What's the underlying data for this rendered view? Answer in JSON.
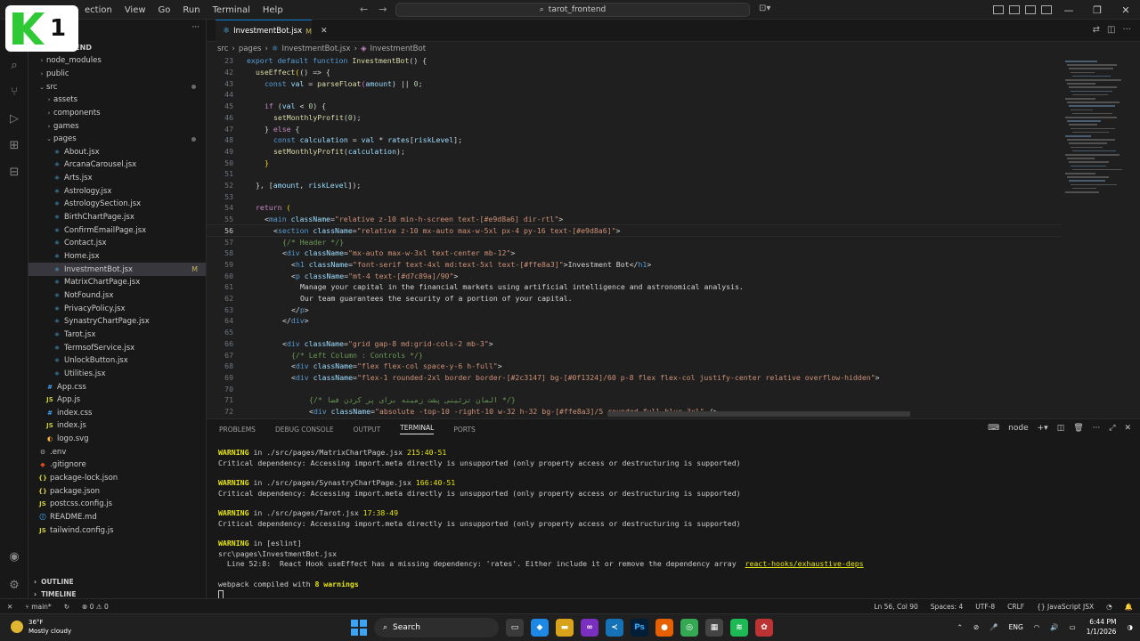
{
  "logo": {
    "number": "1"
  },
  "menu": [
    "ection",
    "View",
    "Go",
    "Run",
    "Terminal",
    "Help"
  ],
  "search": {
    "label": "tarot_frontend"
  },
  "explorer": {
    "root": "NTEND",
    "items": [
      {
        "label": "node_modules",
        "kind": "folder",
        "depth": 1,
        "open": false
      },
      {
        "label": "public",
        "kind": "folder",
        "depth": 1,
        "open": false
      },
      {
        "label": "src",
        "kind": "folder",
        "depth": 1,
        "open": true,
        "dot": true
      },
      {
        "label": "assets",
        "kind": "folder",
        "depth": 2,
        "open": false
      },
      {
        "label": "components",
        "kind": "folder",
        "depth": 2,
        "open": false
      },
      {
        "label": "games",
        "kind": "folder",
        "depth": 2,
        "open": false
      },
      {
        "label": "pages",
        "kind": "folder",
        "depth": 2,
        "open": true,
        "dot": true
      },
      {
        "label": "About.jsx",
        "kind": "jsx",
        "depth": 3
      },
      {
        "label": "ArcanaCarousel.jsx",
        "kind": "jsx",
        "depth": 3
      },
      {
        "label": "Arts.jsx",
        "kind": "jsx",
        "depth": 3
      },
      {
        "label": "Astrology.jsx",
        "kind": "jsx",
        "depth": 3
      },
      {
        "label": "AstrologySection.jsx",
        "kind": "jsx",
        "depth": 3
      },
      {
        "label": "BirthChartPage.jsx",
        "kind": "jsx",
        "depth": 3
      },
      {
        "label": "ConfirmEmailPage.jsx",
        "kind": "jsx",
        "depth": 3
      },
      {
        "label": "Contact.jsx",
        "kind": "jsx",
        "depth": 3
      },
      {
        "label": "Home.jsx",
        "kind": "jsx",
        "depth": 3
      },
      {
        "label": "InvestmentBot.jsx",
        "kind": "jsx",
        "depth": 3,
        "selected": true,
        "badge": "M"
      },
      {
        "label": "MatrixChartPage.jsx",
        "kind": "jsx",
        "depth": 3
      },
      {
        "label": "NotFound.jsx",
        "kind": "jsx",
        "depth": 3
      },
      {
        "label": "PrivacyPolicy.jsx",
        "kind": "jsx",
        "depth": 3
      },
      {
        "label": "SynastryChartPage.jsx",
        "kind": "jsx",
        "depth": 3
      },
      {
        "label": "Tarot.jsx",
        "kind": "jsx",
        "depth": 3
      },
      {
        "label": "TermsofService.jsx",
        "kind": "jsx",
        "depth": 3
      },
      {
        "label": "UnlockButton.jsx",
        "kind": "jsx",
        "depth": 3
      },
      {
        "label": "Utilities.jsx",
        "kind": "jsx",
        "depth": 3
      },
      {
        "label": "App.css",
        "kind": "css",
        "depth": 2
      },
      {
        "label": "App.js",
        "kind": "js",
        "depth": 2
      },
      {
        "label": "index.css",
        "kind": "css",
        "depth": 2
      },
      {
        "label": "index.js",
        "kind": "js",
        "depth": 2
      },
      {
        "label": "logo.svg",
        "kind": "svg",
        "depth": 2
      },
      {
        "label": ".env",
        "kind": "env",
        "depth": 1
      },
      {
        "label": ".gitignore",
        "kind": "git",
        "depth": 1
      },
      {
        "label": "package-lock.json",
        "kind": "json",
        "depth": 1
      },
      {
        "label": "package.json",
        "kind": "json",
        "depth": 1
      },
      {
        "label": "postcss.config.js",
        "kind": "js",
        "depth": 1
      },
      {
        "label": "README.md",
        "kind": "md",
        "depth": 1
      },
      {
        "label": "tailwind.config.js",
        "kind": "js",
        "depth": 1
      }
    ],
    "outline": "OUTLINE",
    "timeline": "TIMELINE"
  },
  "editor": {
    "tab": {
      "label": "InvestmentBot.jsx",
      "modified": "M"
    },
    "breadcrumb": [
      "src",
      "pages",
      "InvestmentBot.jsx",
      "InvestmentBot"
    ],
    "current_line": 56
  },
  "code_lines": [
    {
      "n": "23"
    },
    {
      "n": "42"
    },
    {
      "n": "43"
    },
    {
      "n": "44"
    },
    {
      "n": "45"
    },
    {
      "n": "46"
    },
    {
      "n": "47"
    },
    {
      "n": "48"
    },
    {
      "n": "49"
    },
    {
      "n": "50"
    },
    {
      "n": "51"
    },
    {
      "n": "52"
    },
    {
      "n": "53"
    },
    {
      "n": "54"
    },
    {
      "n": "55"
    },
    {
      "n": "56"
    },
    {
      "n": "57"
    },
    {
      "n": "58"
    },
    {
      "n": "59"
    },
    {
      "n": "60"
    },
    {
      "n": "61"
    },
    {
      "n": "62"
    },
    {
      "n": "63"
    },
    {
      "n": "64"
    },
    {
      "n": "65"
    },
    {
      "n": "66"
    },
    {
      "n": "67"
    },
    {
      "n": "68"
    },
    {
      "n": "69"
    },
    {
      "n": "70"
    },
    {
      "n": "71"
    },
    {
      "n": "72"
    }
  ],
  "code_text": {
    "l23": [
      "export",
      " default",
      " function",
      " InvestmentBot",
      "() {"
    ],
    "l42": [
      "useEffect",
      "(",
      "() => {"
    ],
    "l43": [
      "const",
      " val",
      " = ",
      "parseFloat",
      "(",
      "amount",
      ") || ",
      "0",
      ";"
    ],
    "l45": [
      "if",
      " (",
      "val",
      " < ",
      "0",
      ") {"
    ],
    "l46": [
      "setMonthlyProfit",
      "(",
      "0",
      ");"
    ],
    "l47": [
      "} ",
      "else",
      " {"
    ],
    "l48": [
      "const",
      " calculation",
      " = ",
      "val",
      " * ",
      "rates",
      "[",
      "riskLevel",
      "];"
    ],
    "l49": [
      "setMonthlyProfit",
      "(",
      "calculation",
      ");"
    ],
    "l50": [
      "}"
    ],
    "l52": [
      "}, [",
      "amount",
      ", ",
      "riskLevel",
      "]);"
    ],
    "l54": [
      "return",
      " ("
    ],
    "l55": [
      "<",
      "main",
      " className",
      "=",
      "\"relative z-10 min-h-screen text-[#e9d8a6] dir-rtl\"",
      ">"
    ],
    "l56": [
      "<",
      "section",
      " className",
      "=",
      "\"relative z-10 mx-auto max-w-5xl px-4 py-16 text-[#e9d8a6]\"",
      ">"
    ],
    "l57": [
      "{/* Header */}"
    ],
    "l58": [
      "<",
      "div",
      " className",
      "=",
      "\"mx-auto max-w-3xl text-center mb-12\"",
      ">"
    ],
    "l59": [
      "<",
      "h1",
      " className",
      "=",
      "\"font-serif text-4xl md:text-5xl text-[#ffe8a3]\"",
      ">",
      "Investment Bot",
      "</",
      "h1",
      ">"
    ],
    "l60": [
      "<",
      "p",
      " className",
      "=",
      "\"mt-4 text-[#d7c89a]/90\"",
      ">"
    ],
    "l61": [
      "Manage your capital in the financial markets using artificial intelligence and astronomical analysis."
    ],
    "l62": [
      "Our team guarantees the security of a portion of your capital."
    ],
    "l63": [
      "</",
      "p",
      ">"
    ],
    "l64": [
      "</",
      "div",
      ">"
    ],
    "l66": [
      "<",
      "div",
      " className",
      "=",
      "\"grid gap-8 md:grid-cols-2 mb-3\"",
      ">"
    ],
    "l67": [
      "{/* Left Column : Controls */}"
    ],
    "l68": [
      "<",
      "div",
      " className",
      "=",
      "\"flex flex-col space-y-6 h-full\"",
      ">"
    ],
    "l69": [
      "<",
      "div",
      " className",
      "=",
      "\"flex-1 rounded-2xl border border-[#2c3147] bg-[#0f1324]/60 p-8 flex flex-col justify-center relative overflow-hidden\"",
      ">"
    ],
    "l71": [
      "{/* المان تزئینی پشت زمینه برای پر کردن فضا */}"
    ],
    "l72": [
      "<",
      "div",
      " className",
      "=",
      "\"absolute -top-10 -right-10 w-32 h-32 bg-[#ffe8a3]/5 rounded-full blur-3xl\"",
      " />"
    ]
  },
  "panel": {
    "tabs": [
      "PROBLEMS",
      "DEBUG CONSOLE",
      "OUTPUT",
      "TERMINAL",
      "PORTS"
    ],
    "active_tab": "TERMINAL",
    "shell": "node",
    "terminal": {
      "w1_label": "WARNING",
      "w1_in": " in ",
      "w1_path": "./src/pages/MatrixChartPage.jsx",
      "w1_loc": " 215:40-51",
      "w1_msg": "Critical dependency: Accessing import.meta directly is unsupported (only property access or destructuring is supported)",
      "w2_label": "WARNING",
      "w2_in": " in ",
      "w2_path": "./src/pages/SynastryChartPage.jsx",
      "w2_loc": " 166:40-51",
      "w2_msg": "Critical dependency: Accessing import.meta directly is unsupported (only property access or destructuring is supported)",
      "w3_label": "WARNING",
      "w3_in": " in ",
      "w3_path": "./src/pages/Tarot.jsx",
      "w3_loc": " 17:38-49",
      "w3_msg": "Critical dependency: Accessing import.meta directly is unsupported (only property access or destructuring is supported)",
      "w4_label": "WARNING",
      "w4_in": " in [eslint]",
      "w4_file": "src\\pages\\InvestmentBot.jsx",
      "w4_msg": "  Line 52:8:  React Hook useEffect has a missing dependency: 'rates'. Either include it or remove the dependency array  ",
      "w4_rule": "react-hooks/exhaustive-deps",
      "compiled_pre": "webpack compiled with ",
      "compiled_count": "8 warnings"
    }
  },
  "statusbar": {
    "branch": "main*",
    "errors": "0",
    "warnings": "0",
    "cursor": "Ln 56, Col 90",
    "spaces": "Spaces: 4",
    "encoding": "UTF-8",
    "eol": "CRLF",
    "language": "JavaScript JSX"
  },
  "taskbar": {
    "weather_temp": "36°F",
    "weather_desc": "Mostly cloudy",
    "search": "Search",
    "lang": "ENG",
    "time": "6:44 PM",
    "date": "1/1/2026"
  },
  "colors": {
    "accent": "#0078d4",
    "warning": "#e5e510",
    "modified": "#c5b35a"
  }
}
